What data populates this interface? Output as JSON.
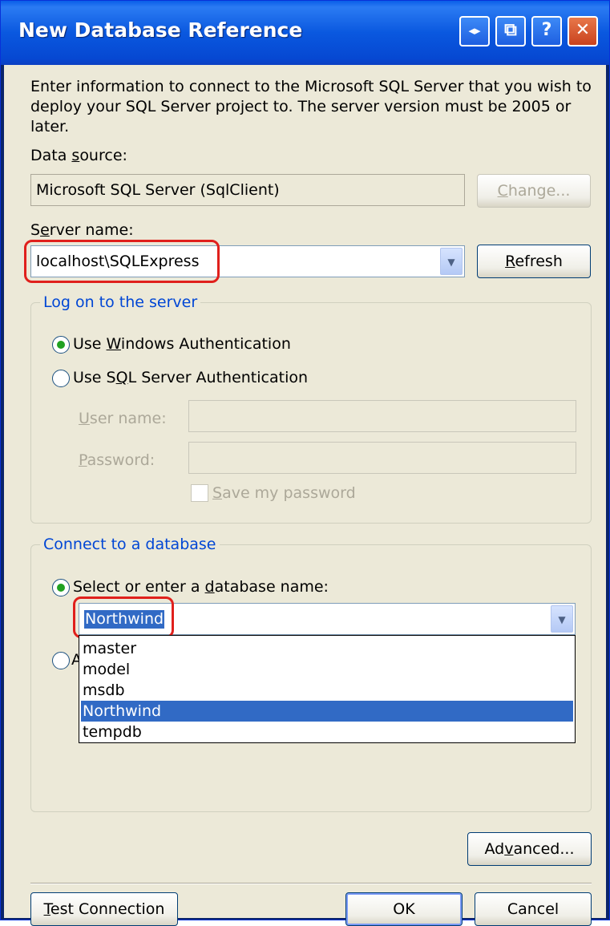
{
  "window": {
    "title": "New Database Reference",
    "controls": [
      "◂▸",
      "⧉",
      "?",
      "✕"
    ]
  },
  "intro": "Enter information to connect to the Microsoft SQL Server that you wish to deploy your SQL Server project to.  The server version must be 2005 or later.",
  "data_source": {
    "label_pre": "Data ",
    "label_u": "s",
    "label_post": "ource:",
    "value": "Microsoft SQL Server (SqlClient)",
    "change_pre": "",
    "change_u": "C",
    "change_post": "hange..."
  },
  "server": {
    "label_pre": "S",
    "label_u": "e",
    "label_post": "rver name:",
    "value": "localhost\\SQLExpress",
    "refresh_pre": "",
    "refresh_u": "R",
    "refresh_post": "efresh"
  },
  "logon": {
    "group_label": "Log on to the server",
    "windows_auth_pre": "Use ",
    "windows_auth_u": "W",
    "windows_auth_post": "indows Authentication",
    "sql_auth_pre": "Use S",
    "sql_auth_u": "Q",
    "sql_auth_post": "L Server Authentication",
    "user_name_pre": "",
    "user_name_u": "U",
    "user_name_post": "ser name:",
    "password_pre": "",
    "password_u": "P",
    "password_post": "assword:",
    "save_password_pre": "",
    "save_password_u": "S",
    "save_password_post": "ave my password"
  },
  "database": {
    "group_label": "Connect to a database",
    "select_pre": "Select or enter a ",
    "select_u": "d",
    "select_post": "atabase name:",
    "value": "Northwind",
    "attach_partial": "A",
    "options": [
      "master",
      "model",
      "msdb",
      "Northwind",
      "tempdb"
    ],
    "selected_option": "Northwind"
  },
  "buttons": {
    "advanced_pre": "Ad",
    "advanced_u": "v",
    "advanced_post": "anced...",
    "test_pre": "",
    "test_u": "T",
    "test_post": "est Connection",
    "ok": "OK",
    "cancel": "Cancel"
  },
  "colors": {
    "titlebar": "#0a58df",
    "highlight": "#e0201c",
    "selection": "#316ac5",
    "group_label": "#0046d5"
  }
}
